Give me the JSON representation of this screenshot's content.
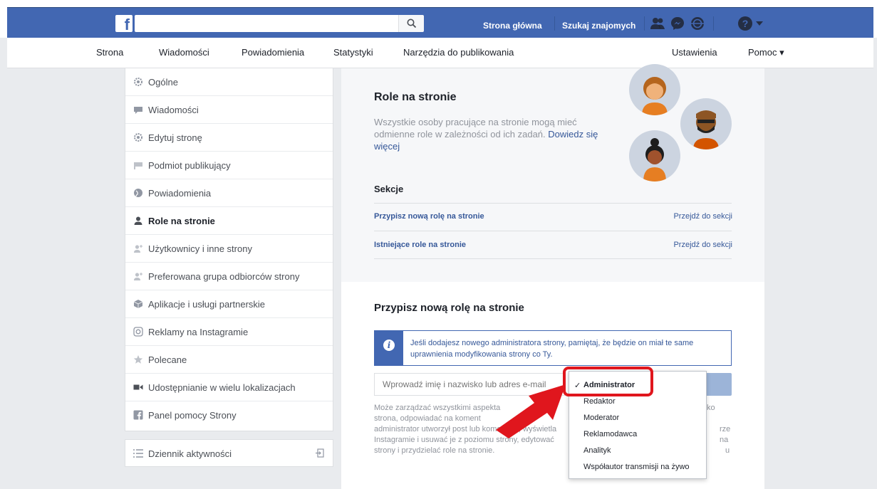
{
  "topbar": {
    "logo": "f",
    "search_placeholder": "",
    "links": [
      "Strona główna",
      "Szukaj znajomych"
    ],
    "icons": [
      "friends-icon",
      "messenger-icon",
      "globe-notifications-icon",
      "help-icon",
      "caret-down-icon"
    ]
  },
  "page_tabs": {
    "left": [
      "Strona",
      "Wiadomości",
      "Powiadomienia",
      "Statystyki",
      "Narzędzia do publikowania"
    ],
    "right": [
      "Ustawienia",
      "Pomoc ▾"
    ]
  },
  "sidebar": {
    "items": [
      {
        "label": "Ogólne",
        "icon": "gear-icon"
      },
      {
        "label": "Wiadomości",
        "icon": "message-icon"
      },
      {
        "label": "Edytuj stronę",
        "icon": "gear-icon"
      },
      {
        "label": "Podmiot publikujący",
        "icon": "flag-icon"
      },
      {
        "label": "Powiadomienia",
        "icon": "globe-icon"
      },
      {
        "label": "Role na stronie",
        "icon": "person-icon",
        "active": true
      },
      {
        "label": "Użytkownicy i inne strony",
        "icon": "person-plus-icon"
      },
      {
        "label": "Preferowana grupa odbiorców strony",
        "icon": "person-plus-icon"
      },
      {
        "label": "Aplikacje i usługi partnerskie",
        "icon": "cube-icon"
      },
      {
        "label": "Reklamy na Instagramie",
        "icon": "instagram-icon"
      },
      {
        "label": "Polecane",
        "icon": "star-icon"
      },
      {
        "label": "Udostępnianie w wielu lokalizacjach",
        "icon": "video-icon"
      },
      {
        "label": "Panel pomocy Strony",
        "icon": "facebook-icon"
      }
    ],
    "activity_label": "Dziennik aktywności"
  },
  "roles": {
    "title": "Role na stronie",
    "desc_text": "Wszystkie osoby pracujące na stronie mogą mieć odmienne role w zależności od ich zadań. ",
    "desc_link": "Dowiedz się więcej",
    "sections_label": "Sekcje",
    "sections": [
      {
        "label": "Przypisz nową rolę na stronie",
        "action": "Przejdź do sekcji"
      },
      {
        "label": "Istniejące role na stronie",
        "action": "Przejdź do sekcji"
      }
    ]
  },
  "assign": {
    "title": "Przypisz nową rolę na stronie",
    "info": "Jeśli dodajesz nowego administratora strony, pamiętaj, że będzie on miał te same uprawnienia modyfikowania strony co Ty.",
    "input_placeholder": "Wprowadź imię i nazwisko lub adres e-mail",
    "desc_lines": [
      "Może zarządzać wszystkimi aspekta",
      "strona, odpowiadać na koment",
      "administrator utworzył post lub komentarz, wyświetla",
      "Instagramie i usuwać je z poziomu strony, edytować",
      "strony i przydzielać role na stronie."
    ],
    "desc_right": [
      "ko",
      "",
      "rze na",
      "u",
      ""
    ]
  },
  "dropdown": {
    "selected": "Administrator",
    "options": [
      "Administrator",
      "Redaktor",
      "Moderator",
      "Reklamodawca",
      "Analityk",
      "Współautor transmisji na żywo"
    ]
  },
  "colors": {
    "brand": "#4267b2",
    "link": "#365899",
    "highlight": "#e0161d"
  }
}
